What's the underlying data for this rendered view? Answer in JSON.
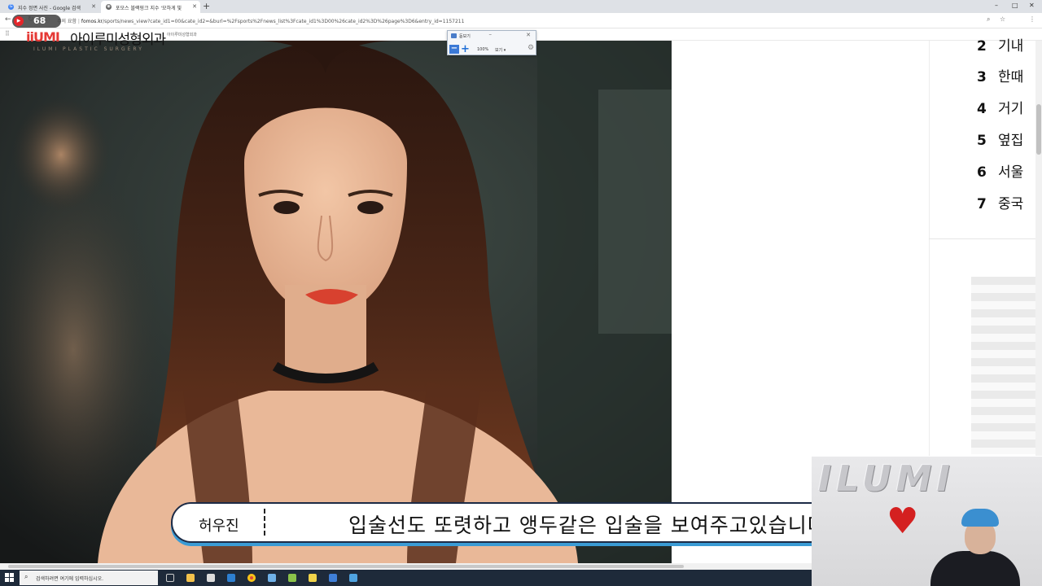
{
  "browser": {
    "tabs": [
      {
        "label": "지수 정면 사진 - Google 검색",
        "active": false
      },
      {
        "label": "포모스 블랙핑크 지수 '모하게 빛",
        "active": true
      }
    ],
    "new_tab_glyph": "+",
    "window_controls": [
      "–",
      "□",
      "✕"
    ],
    "security_label": "주의 요함",
    "url_host": "fomos.kr",
    "url_path": "/sports/news_view?cate_id1=00&cate_id2=&burl=%2Fsports%2Fnews_list%3Fcate_id1%3D00%26cate_id2%3D%26page%3D6&entry_id=1157211",
    "bookmark_label": "아이루미성형외과"
  },
  "logo": {
    "play_count": "68",
    "mark": "iiUMI",
    "korean": "아이루미성형외과",
    "english": "ILUMI PLASTIC SURGERY"
  },
  "magnifier": {
    "title": "돋보기",
    "zoom": "100%",
    "view_label": "보기 ▾",
    "minus": "−",
    "plus": "+"
  },
  "ranking": [
    {
      "rank": "2",
      "text": "기내"
    },
    {
      "rank": "3",
      "text": "한때"
    },
    {
      "rank": "4",
      "text": "거기"
    },
    {
      "rank": "5",
      "text": "옆집"
    },
    {
      "rank": "6",
      "text": "서울"
    },
    {
      "rank": "7",
      "text": "중국"
    }
  ],
  "subtitle": {
    "speaker": "허우진",
    "text": "입술선도 또렷하고 앵두같은 입술을 보여주고있습니다"
  },
  "webcam": {
    "balloon_text": "ILUMI"
  },
  "taskbar": {
    "search_placeholder": "검색하려면 여기에 입력하십시오."
  },
  "colors": {
    "logo_red": "#e53935",
    "subtitle_border": "#1d2b46",
    "subtitle_shadow": "#3a9bd5",
    "taskbar": "#1e2a3a"
  }
}
